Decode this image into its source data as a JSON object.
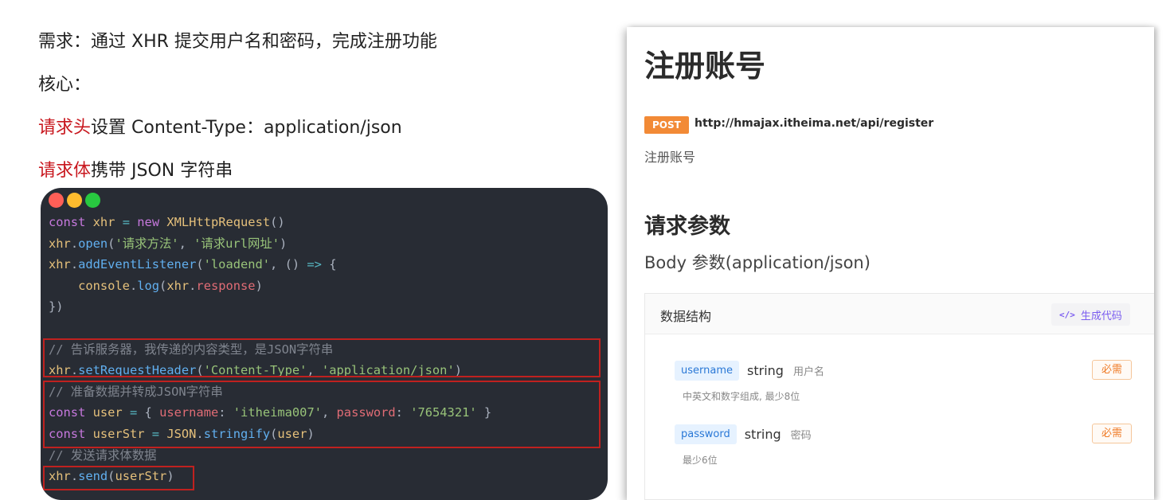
{
  "notes": {
    "requirement": "需求：通过 XHR 提交用户名和密码，完成注册功能",
    "core": "核心：",
    "header_hl": "请求头",
    "header_rest": "设置 Content-Type：application/json",
    "body_hl": "请求体",
    "body_rest": "携带 JSON 字符串",
    "highlight_color": "#c8161d"
  },
  "code_window": {
    "dots": [
      {
        "name": "close-dot",
        "color": "#ff5f57"
      },
      {
        "name": "minimize-dot",
        "color": "#febc2e"
      },
      {
        "name": "maximize-dot",
        "color": "#28c840"
      }
    ],
    "lines": [
      [
        [
          "kw",
          "const"
        ],
        [
          "pl",
          " "
        ],
        [
          "ty",
          "xhr"
        ],
        [
          "pl",
          " "
        ],
        [
          "op",
          "="
        ],
        [
          "pl",
          " "
        ],
        [
          "kw",
          "new"
        ],
        [
          "pl",
          " "
        ],
        [
          "ty",
          "XMLHttpRequest"
        ],
        [
          "pn",
          "()"
        ]
      ],
      [
        [
          "ty",
          "xhr"
        ],
        [
          "pn",
          "."
        ],
        [
          "fn",
          "open"
        ],
        [
          "pn",
          "("
        ],
        [
          "st",
          "'请求方法'"
        ],
        [
          "pn",
          ", "
        ],
        [
          "st",
          "'请求url网址'"
        ],
        [
          "pn",
          ")"
        ]
      ],
      [
        [
          "ty",
          "xhr"
        ],
        [
          "pn",
          "."
        ],
        [
          "fn",
          "addEventListener"
        ],
        [
          "pn",
          "("
        ],
        [
          "st",
          "'loadend'"
        ],
        [
          "pn",
          ", "
        ],
        [
          "pn",
          "() "
        ],
        [
          "op",
          "=>"
        ],
        [
          "pn",
          " {"
        ]
      ],
      [
        [
          "pl",
          "    "
        ],
        [
          "ty",
          "console"
        ],
        [
          "pn",
          "."
        ],
        [
          "fn",
          "log"
        ],
        [
          "pn",
          "("
        ],
        [
          "ty",
          "xhr"
        ],
        [
          "pn",
          "."
        ],
        [
          "pr",
          "response"
        ],
        [
          "pn",
          ")"
        ]
      ],
      [
        [
          "pn",
          "})"
        ]
      ],
      [],
      [
        [
          "cm",
          "// 告诉服务器，我传递的内容类型，是JSON字符串"
        ]
      ],
      [
        [
          "ty",
          "xhr"
        ],
        [
          "pn",
          "."
        ],
        [
          "fn",
          "setRequestHeader"
        ],
        [
          "pn",
          "("
        ],
        [
          "st",
          "'Content-Type'"
        ],
        [
          "pn",
          ", "
        ],
        [
          "st",
          "'application/json'"
        ],
        [
          "pn",
          ")"
        ]
      ],
      [
        [
          "cm",
          "// 准备数据并转成JSON字符串"
        ]
      ],
      [
        [
          "kw",
          "const"
        ],
        [
          "pl",
          " "
        ],
        [
          "ty",
          "user"
        ],
        [
          "pl",
          " "
        ],
        [
          "op",
          "="
        ],
        [
          "pl",
          " "
        ],
        [
          "pn",
          "{ "
        ],
        [
          "pr",
          "username"
        ],
        [
          "pn",
          ": "
        ],
        [
          "st",
          "'itheima007'"
        ],
        [
          "pn",
          ", "
        ],
        [
          "pr",
          "password"
        ],
        [
          "pn",
          ": "
        ],
        [
          "st",
          "'7654321'"
        ],
        [
          "pn",
          " }"
        ]
      ],
      [
        [
          "kw",
          "const"
        ],
        [
          "pl",
          " "
        ],
        [
          "ty",
          "userStr"
        ],
        [
          "pl",
          " "
        ],
        [
          "op",
          "="
        ],
        [
          "pl",
          " "
        ],
        [
          "ty",
          "JSON"
        ],
        [
          "pn",
          "."
        ],
        [
          "fn",
          "stringify"
        ],
        [
          "pn",
          "("
        ],
        [
          "ty",
          "user"
        ],
        [
          "pn",
          ")"
        ]
      ],
      [
        [
          "cm",
          "// 发送请求体数据"
        ]
      ],
      [
        [
          "ty",
          "xhr"
        ],
        [
          "pn",
          "."
        ],
        [
          "fn",
          "send"
        ],
        [
          "pn",
          "("
        ],
        [
          "ty",
          "userStr"
        ],
        [
          "pn",
          ")"
        ]
      ]
    ]
  },
  "doc": {
    "title": "注册账号",
    "method": "POST",
    "url": "http://hmajax.itheima.net/api/register",
    "description": "注册账号",
    "params_heading": "请求参数",
    "body_subheading": "Body 参数(application/json)",
    "schema_title": "数据结构",
    "generate_icon": "</>",
    "generate_label": "生成代码",
    "fields": [
      {
        "name": "username",
        "type": "string",
        "label": "用户名",
        "note": "中英文和数字组成, 最少8位",
        "required": "必需"
      },
      {
        "name": "password",
        "type": "string",
        "label": "密码",
        "note": "最少6位",
        "required": "必需"
      }
    ]
  }
}
